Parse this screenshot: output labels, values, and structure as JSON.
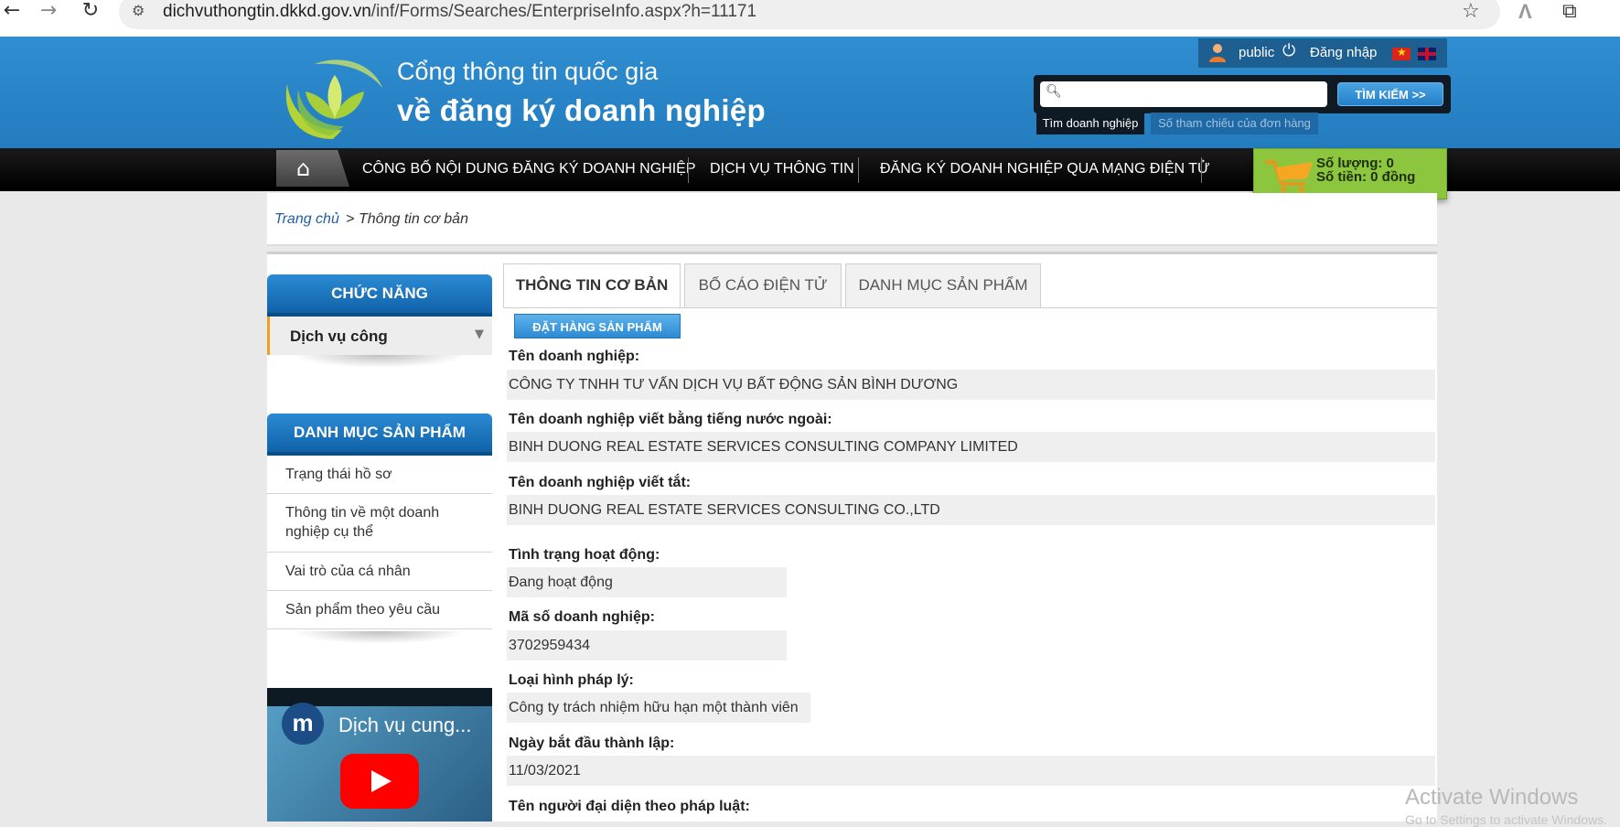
{
  "browser": {
    "url_host": "dichvuthongtin.dkkd.gov.vn",
    "url_path": "/inf/Forms/Searches/EnterpriseInfo.aspx?h=11171",
    "back_icon": "arrow-left-icon",
    "forward_icon": "arrow-right-icon",
    "reload_icon": "reload-icon"
  },
  "header": {
    "logo_line1": "Cổng thông tin quốc gia",
    "logo_line2": "về đăng ký doanh nghiệp",
    "user_name": "public",
    "login_label": "Đăng nhập",
    "search_button": "TÌM KIẾM >>",
    "search_value": "",
    "search_tab_active": "Tìm doanh nghiệp",
    "search_tab_other": "Số tham chiếu của đơn hàng"
  },
  "nav": {
    "items": [
      "CÔNG BỐ NỘI DUNG ĐĂNG KÝ DOANH NGHIỆP",
      "DỊCH VỤ THÔNG TIN",
      "ĐĂNG KÝ DOANH NGHIỆP QUA MẠNG ĐIỆN TỬ"
    ]
  },
  "cart": {
    "quantity": "Số lượng: 0",
    "amount": "Số tiền: 0 đồng"
  },
  "breadcrumb": {
    "home": "Trang chủ",
    "separator": ">",
    "current": "Thông tin cơ bản"
  },
  "sidebar": {
    "function_header": "CHỨC NĂNG",
    "function_select": "Dịch vụ công",
    "catalog_header": "DANH MỤC SẢN PHẨM",
    "items": [
      "Trạng thái hồ sơ",
      "Thông tin về một doanh nghiệp cụ thể",
      "Vai trò của cá nhân",
      "Sản phẩm theo yêu cầu"
    ],
    "video": {
      "channel_letter": "m",
      "title": "Dịch vụ cung..."
    }
  },
  "tabs": [
    "THÔNG TIN CƠ BẢN",
    "BỐ CÁO ĐIỆN TỬ",
    "DANH MỤC SẢN PHẨM"
  ],
  "order_button": "ĐẶT HÀNG SẢN PHẨM",
  "fields": [
    {
      "label": "Tên doanh nghiệp:",
      "value": "CÔNG TY TNHH TƯ VẤN DỊCH VỤ BẤT ĐỘNG SẢN BÌNH DƯƠNG"
    },
    {
      "label": "Tên doanh nghiệp viết bằng tiếng nước ngoài:",
      "value": "BINH DUONG REAL ESTATE SERVICES CONSULTING COMPANY LIMITED"
    },
    {
      "label": "Tên doanh nghiệp viết tắt:",
      "value": "BINH DUONG REAL ESTATE SERVICES CONSULTING CO.,LTD"
    },
    {
      "label": "Tình trạng hoạt động:",
      "value": "Đang hoạt động"
    },
    {
      "label": "Mã số doanh nghiệp:",
      "value": "3702959434"
    },
    {
      "label": "Loại hình pháp lý:",
      "value": "Công ty trách nhiệm hữu hạn một thành viên"
    },
    {
      "label": "Ngày bắt đầu thành lập:",
      "value": "11/03/2021"
    },
    {
      "label": "Tên người đại diện theo pháp luật:",
      "value": ""
    }
  ],
  "watermark": {
    "line1": "Activate Windows",
    "line2": "Go to Settings to activate Windows."
  }
}
